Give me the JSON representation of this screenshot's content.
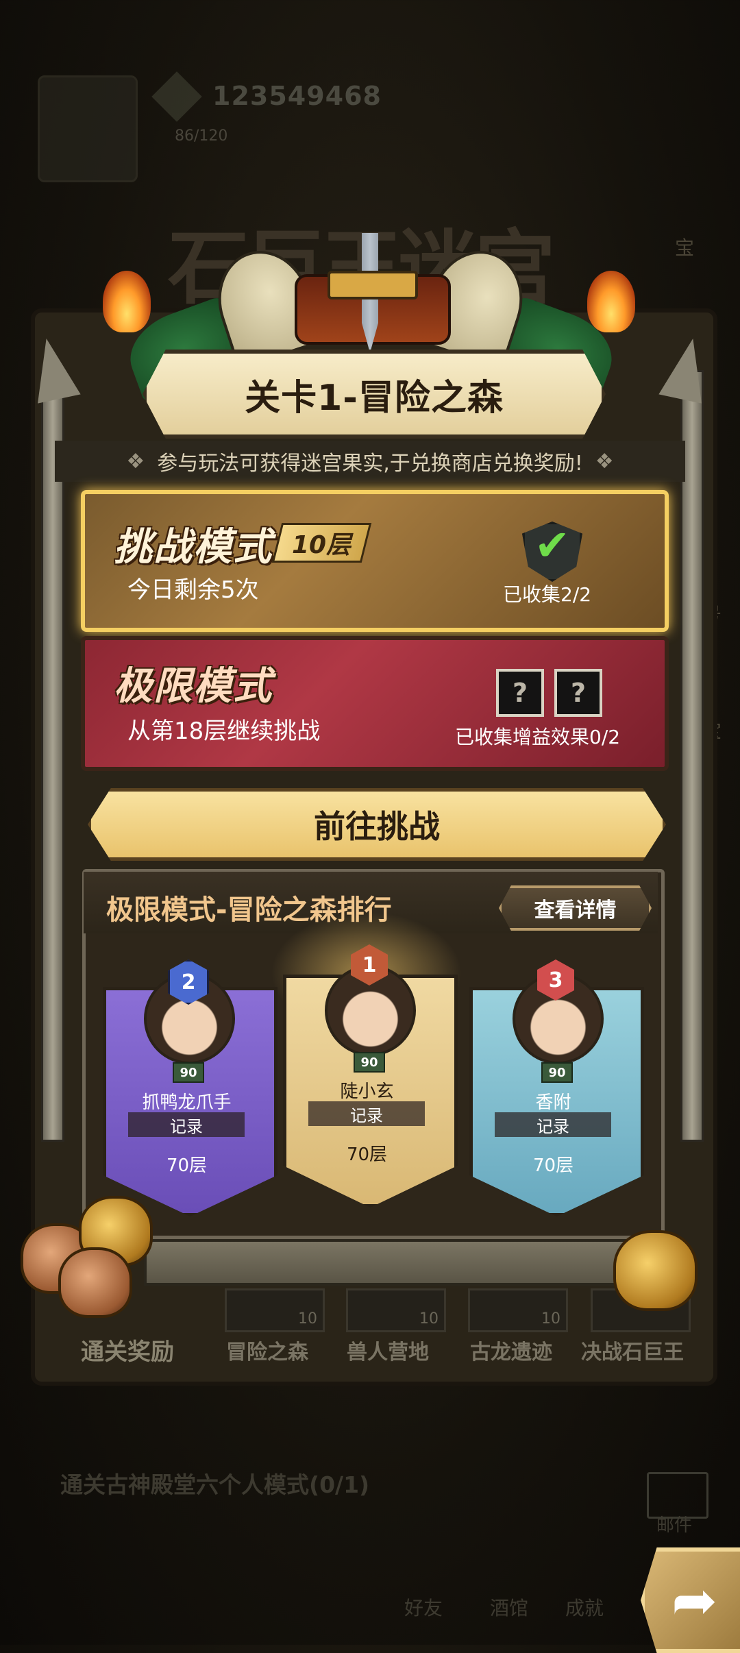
{
  "background": {
    "player_id": "123549468",
    "sub_stat": "86/120",
    "event_title": "石巨王迷宫",
    "side_label_a": "宝",
    "side_label_b": "号",
    "side_label_c": "宝",
    "quest_text": "通关古神殿堂六个人模式(0/1)",
    "mail_label": "邮件",
    "nav_friends": "好友",
    "nav_tavern": "酒馆",
    "nav_achievements": "成就"
  },
  "stage": {
    "title": "关卡1-冒险之森",
    "info": "参与玩法可获得迷宫果实,于兑换商店兑换奖励!"
  },
  "challenge_mode": {
    "title": "挑战模式",
    "floors": "10层",
    "remaining": "今日剩余5次",
    "collected": "已收集2/2"
  },
  "extreme_mode": {
    "title": "极限模式",
    "continue": "从第18层继续挑战",
    "collected": "已收集增益效果0/2",
    "slot_symbol": "?"
  },
  "go_button": {
    "label": "前往挑战"
  },
  "leaderboard": {
    "title": "极限模式-冒险之森排行",
    "details_label": "查看详情",
    "record_label": "记录",
    "entries": [
      {
        "rank": "1",
        "name": "陡小玄",
        "level": "90",
        "floors": "70层"
      },
      {
        "rank": "2",
        "name": "抓鸭龙爪手",
        "level": "90",
        "floors": "70层"
      },
      {
        "rank": "3",
        "name": "香附",
        "level": "90",
        "floors": "70层"
      }
    ]
  },
  "bottom_tabs": {
    "rewards": "通关奖励",
    "forest": "冒险之森",
    "orc": "兽人营地",
    "dragon": "古龙遗迹",
    "final": "决战石巨王",
    "thumb_value": "10"
  },
  "colors": {
    "challenge_border": "#f5cf62",
    "extreme_bg": "#8d2733",
    "gold_button": "#e9c36c",
    "rank2": "#6a4eb7",
    "rank1": "#d9b874",
    "rank3": "#68a9bf"
  }
}
